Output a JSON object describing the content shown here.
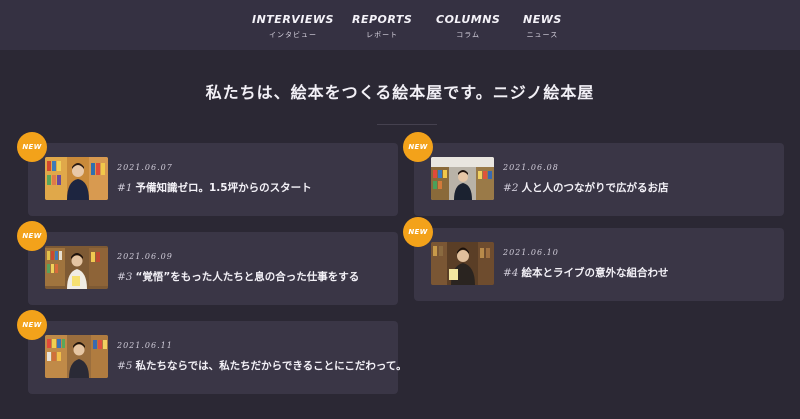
{
  "nav": [
    {
      "en": "INTERVIEWS",
      "jp": "インタビュー"
    },
    {
      "en": "REPORTS",
      "jp": "レポート"
    },
    {
      "en": "COLUMNS",
      "jp": "コラム"
    },
    {
      "en": "NEWS",
      "jp": "ニュース"
    }
  ],
  "tagline": "私たちは、絵本をつくる絵本屋です。ニジノ絵本屋",
  "badge_label": "NEW",
  "articles": [
    {
      "date": "2021.06.07",
      "num": "#1",
      "title": "予備知識ゼロ。1.5坪からのスタート"
    },
    {
      "date": "2021.06.08",
      "num": "#2",
      "title": "人と人のつながりで広がるお店"
    },
    {
      "date": "2021.06.09",
      "num": "#3",
      "title": "“覚悟”をもった人たちと息の合った仕事をする"
    },
    {
      "date": "2021.06.10",
      "num": "#4",
      "title": "絵本とライブの意外な組合わせ"
    },
    {
      "date": "2021.06.11",
      "num": "#5",
      "title": "私たちならでは、私たちだからできることにこだわって。"
    }
  ],
  "colors": {
    "background": "#2b2834",
    "nav_background": "#353142",
    "card_background": "#3a3646",
    "badge": "#f3a21a"
  }
}
